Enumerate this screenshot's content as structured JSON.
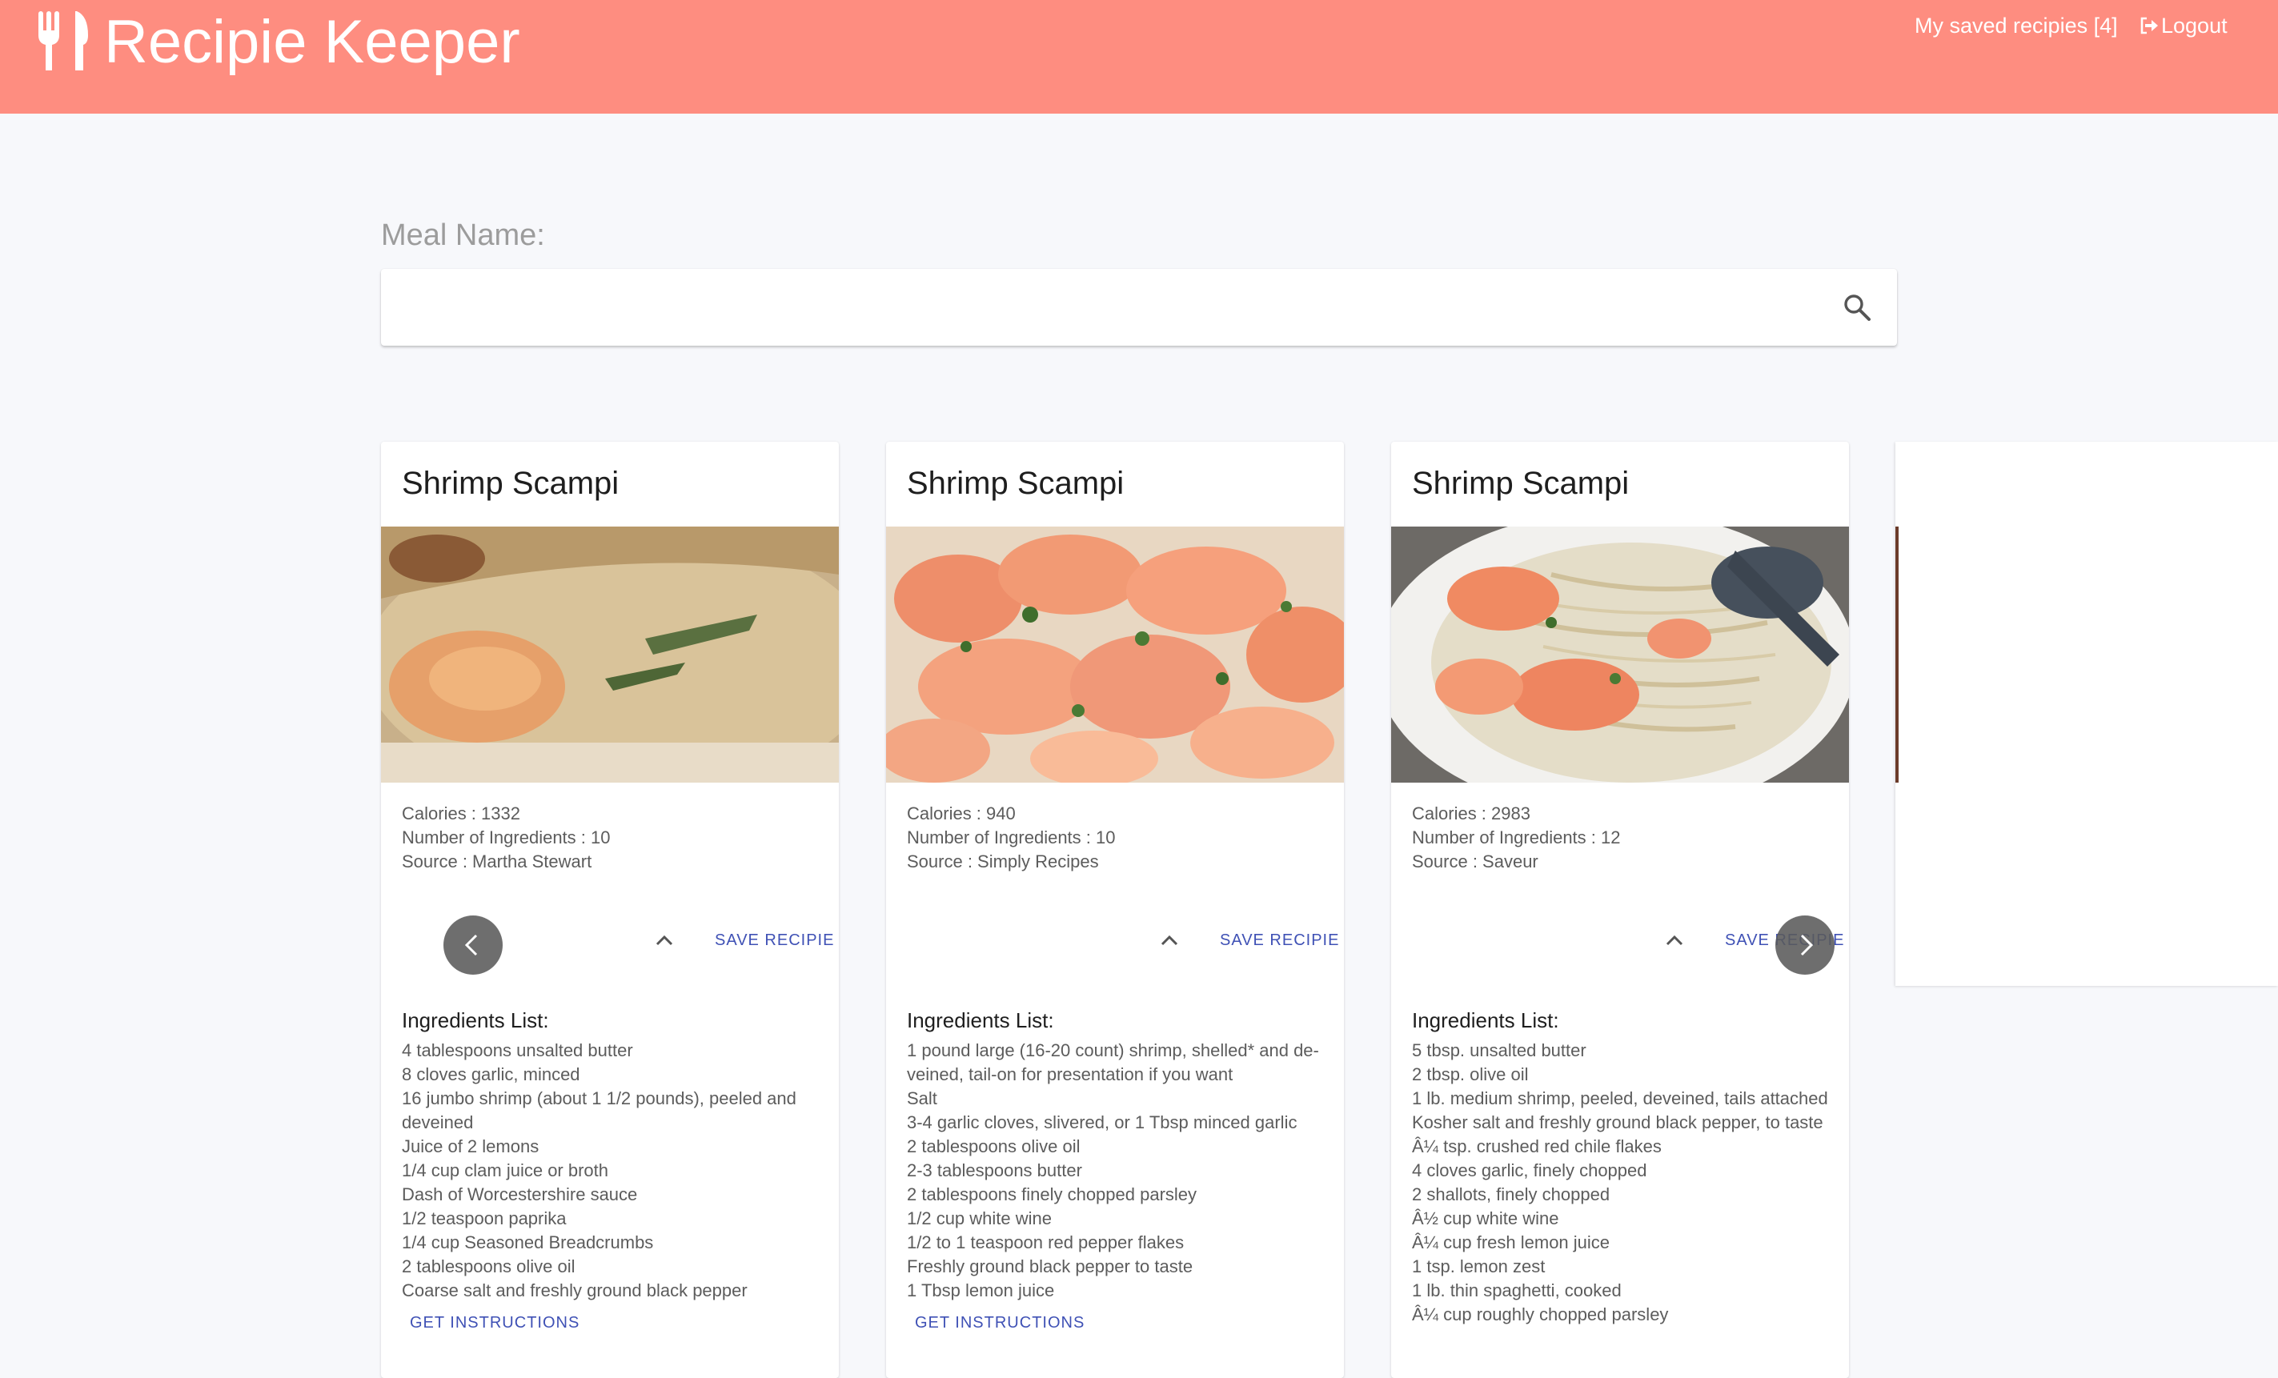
{
  "app": {
    "title": "Recipie Keeper"
  },
  "nav": {
    "saved_label": "My saved recipies [4]",
    "logout_label": "Logout"
  },
  "search": {
    "label": "Meal Name:",
    "value": "",
    "placeholder": ""
  },
  "cards": [
    {
      "title": "Shrimp Scampi",
      "calories": "Calories : 1332",
      "ingredients_count": "Number of Ingredients : 10",
      "source": "Source : Martha Stewart",
      "save_label": "SAVE RECIPIE",
      "ingredients_title": "Ingredients List:",
      "ingredients": [
        "4 tablespoons unsalted butter",
        "8 cloves garlic, minced",
        "16 jumbo shrimp (about 1 1/2 pounds), peeled and deveined",
        "Juice of 2 lemons",
        "1/4 cup clam juice or broth",
        "Dash of Worcestershire sauce",
        "1/2 teaspoon paprika",
        "1/4 cup Seasoned Breadcrumbs",
        "2 tablespoons olive oil",
        "Coarse salt and freshly ground black pepper"
      ],
      "instructions_label": "GET INSTRUCTIONS"
    },
    {
      "title": "Shrimp Scampi",
      "calories": "Calories : 940",
      "ingredients_count": "Number of Ingredients : 10",
      "source": "Source : Simply Recipes",
      "save_label": "SAVE RECIPIE",
      "ingredients_title": "Ingredients List:",
      "ingredients": [
        "1 pound large (16-20 count) shrimp, shelled* and de-veined, tail-on for presentation if you want",
        "Salt",
        "3-4 garlic cloves, slivered, or 1 Tbsp minced garlic",
        "2 tablespoons olive oil",
        "2-3 tablespoons butter",
        "2 tablespoons finely chopped parsley",
        "1/2 cup white wine",
        "1/2 to 1 teaspoon red pepper flakes",
        "Freshly ground black pepper to taste",
        "1 Tbsp lemon juice"
      ],
      "instructions_label": "GET INSTRUCTIONS"
    },
    {
      "title": "Shrimp Scampi",
      "calories": "Calories : 2983",
      "ingredients_count": "Number of Ingredients : 12",
      "source": "Source : Saveur",
      "save_label": "SAVE RECIPIE",
      "ingredients_title": "Ingredients List:",
      "ingredients": [
        "5 tbsp. unsalted butter",
        "2 tbsp. olive oil",
        "1 lb. medium shrimp, peeled, deveined, tails attached",
        "Kosher salt and freshly ground black pepper, to taste",
        "Â¼ tsp. crushed red chile flakes",
        "4 cloves garlic, finely chopped",
        "2 shallots, finely chopped",
        "Â½ cup white wine",
        "Â¼ cup fresh lemon juice",
        "1 tsp. lemon zest",
        "1 lb. thin spaghetti, cooked",
        "Â¼ cup roughly chopped parsley"
      ],
      "instructions_label": "GET INSTRUCTIONS"
    }
  ],
  "colors": {
    "header": "#fe8d80",
    "accent": "#3f51b5"
  },
  "icons": {
    "logo": "fork-knife-icon",
    "logout": "logout-icon",
    "search": "search-icon",
    "collapse": "chevron-up-icon",
    "carousel_prev": "chevron-left-icon",
    "carousel_next": "chevron-right-icon"
  }
}
